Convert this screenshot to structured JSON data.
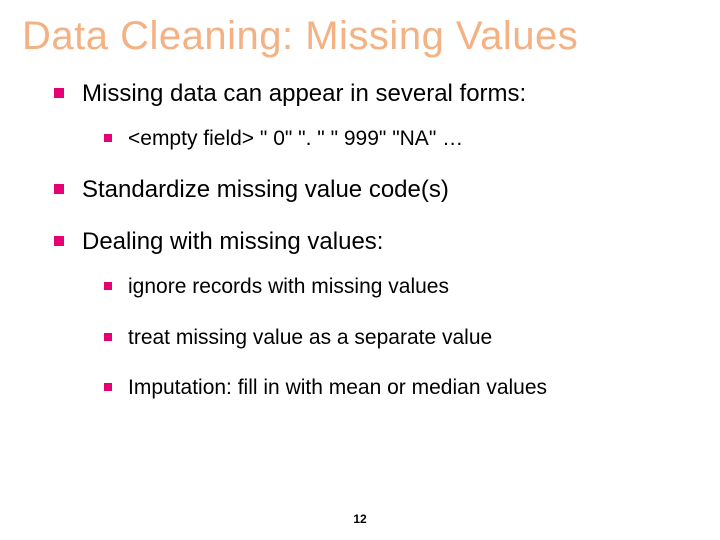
{
  "title": "Data Cleaning: Missing Values",
  "bullets": [
    {
      "text": "Missing data can appear in several forms:",
      "children": [
        {
          "text": "<empty field>  \" 0\"   \". \"  \" 999\"  \"NA\"  …"
        }
      ]
    },
    {
      "text": "Standardize missing value code(s)"
    },
    {
      "text": "Dealing with missing values:",
      "children": [
        {
          "text": "ignore records with missing values"
        },
        {
          "text": "treat missing value as a separate value"
        },
        {
          "text": "Imputation: fill in with mean or median values"
        }
      ]
    }
  ],
  "page_number": "12"
}
